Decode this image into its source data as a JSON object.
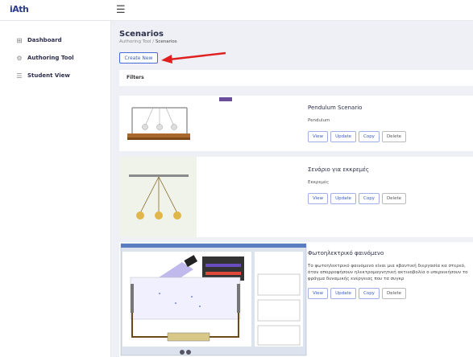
{
  "app": {
    "logo": "iAth"
  },
  "sidebar": {
    "items": [
      {
        "label": "Dashboard",
        "icon": "grid-icon"
      },
      {
        "label": "Authoring Tool",
        "icon": "gear-icon"
      },
      {
        "label": "Student View",
        "icon": "list-icon"
      }
    ]
  },
  "header": {
    "title": "Scenarios",
    "breadcrumb": {
      "root": "Authoring Tool",
      "separator": "/",
      "current": "Scenarios"
    }
  },
  "create_label": "Create New",
  "filters_label": "Filters",
  "scenarios": [
    {
      "title": "Pendulum Scenario",
      "subtitle": "Pendulum",
      "description": ""
    },
    {
      "title": "Σενάριο για εκκρεμές",
      "subtitle": "Εκκρεμές",
      "description": ""
    },
    {
      "title": "Φωτοηλεκτρικό φαινόμενο",
      "subtitle": "",
      "description": "Το φωτοηλεκτρικό φαινόμενο είναι μια κβαντική διεργασία κα στερεό, όταν απορροφήσουν ηλεκτρομαγνητική ακτινοβολία ο υπερνικήσουν το φράγμα δυναμικής ενέργειας που τα συγκρ"
    }
  ],
  "actions": {
    "view": "View",
    "update": "Update",
    "copy": "Copy",
    "delete": "Delete"
  },
  "colors": {
    "accent": "#3a5bc7",
    "arrow": "#e02020",
    "logo": "#2b3a8f"
  }
}
